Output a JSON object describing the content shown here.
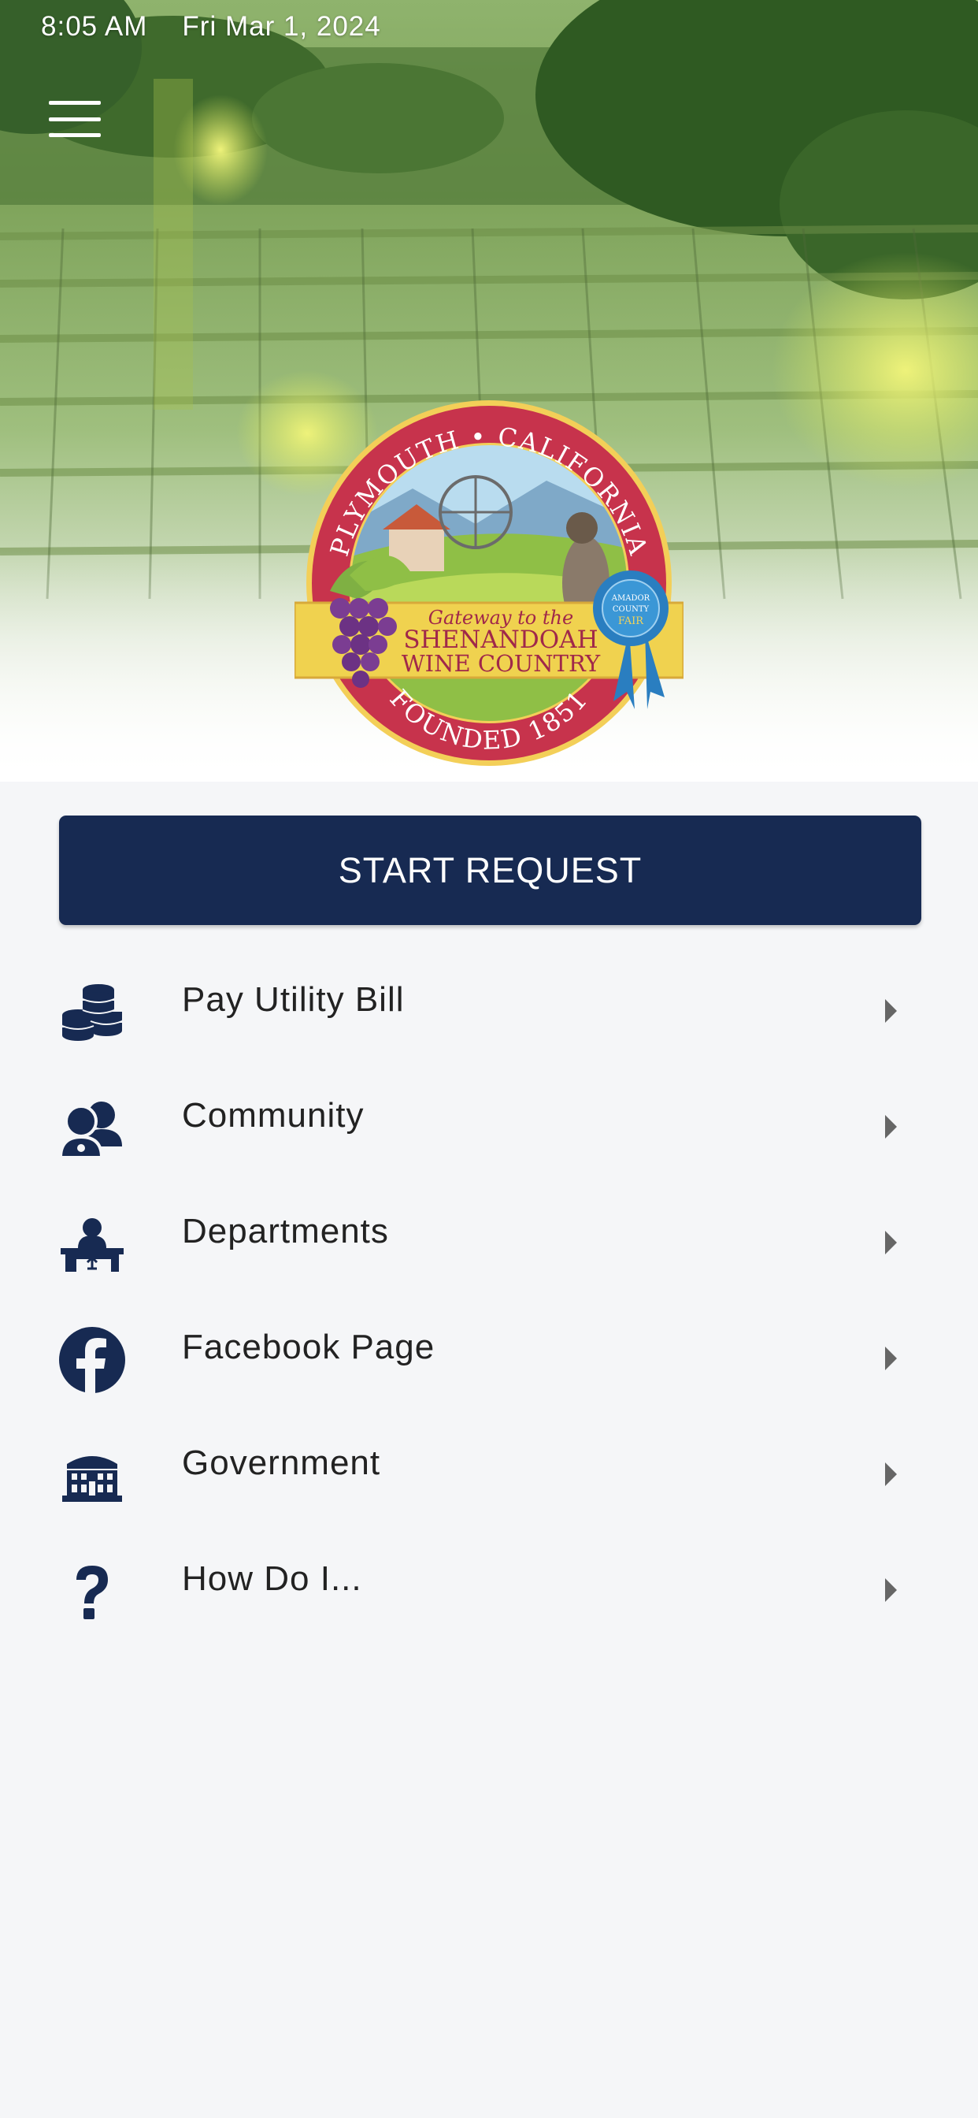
{
  "status_bar": {
    "time": "8:05 AM",
    "date": "Fri Mar 1, 2024"
  },
  "header": {
    "menu_icon": "hamburger-menu-icon"
  },
  "seal": {
    "top_text": "PLYMOUTH • CALIFORNIA",
    "tagline": "Gateway to the",
    "line1": "SHENANDOAH",
    "line2": "WINE COUNTRY",
    "bottom_text": "FOUNDED 1851",
    "ribbon": [
      "AMADOR",
      "COUNTY",
      "FAIR"
    ]
  },
  "start_request": {
    "label": "START REQUEST"
  },
  "menu": {
    "items": [
      {
        "label": "Pay Utility Bill",
        "icon": "coins-icon"
      },
      {
        "label": "Community",
        "icon": "users-icon"
      },
      {
        "label": "Departments",
        "icon": "person-at-desk-icon"
      },
      {
        "label": "Facebook Page",
        "icon": "facebook-icon"
      },
      {
        "label": "Government",
        "icon": "government-building-icon"
      },
      {
        "label": "How Do I...",
        "icon": "question-mark-icon"
      }
    ]
  },
  "colors": {
    "brand_navy": "#172a52",
    "background": "#f5f6f8",
    "chevron": "#666666"
  }
}
